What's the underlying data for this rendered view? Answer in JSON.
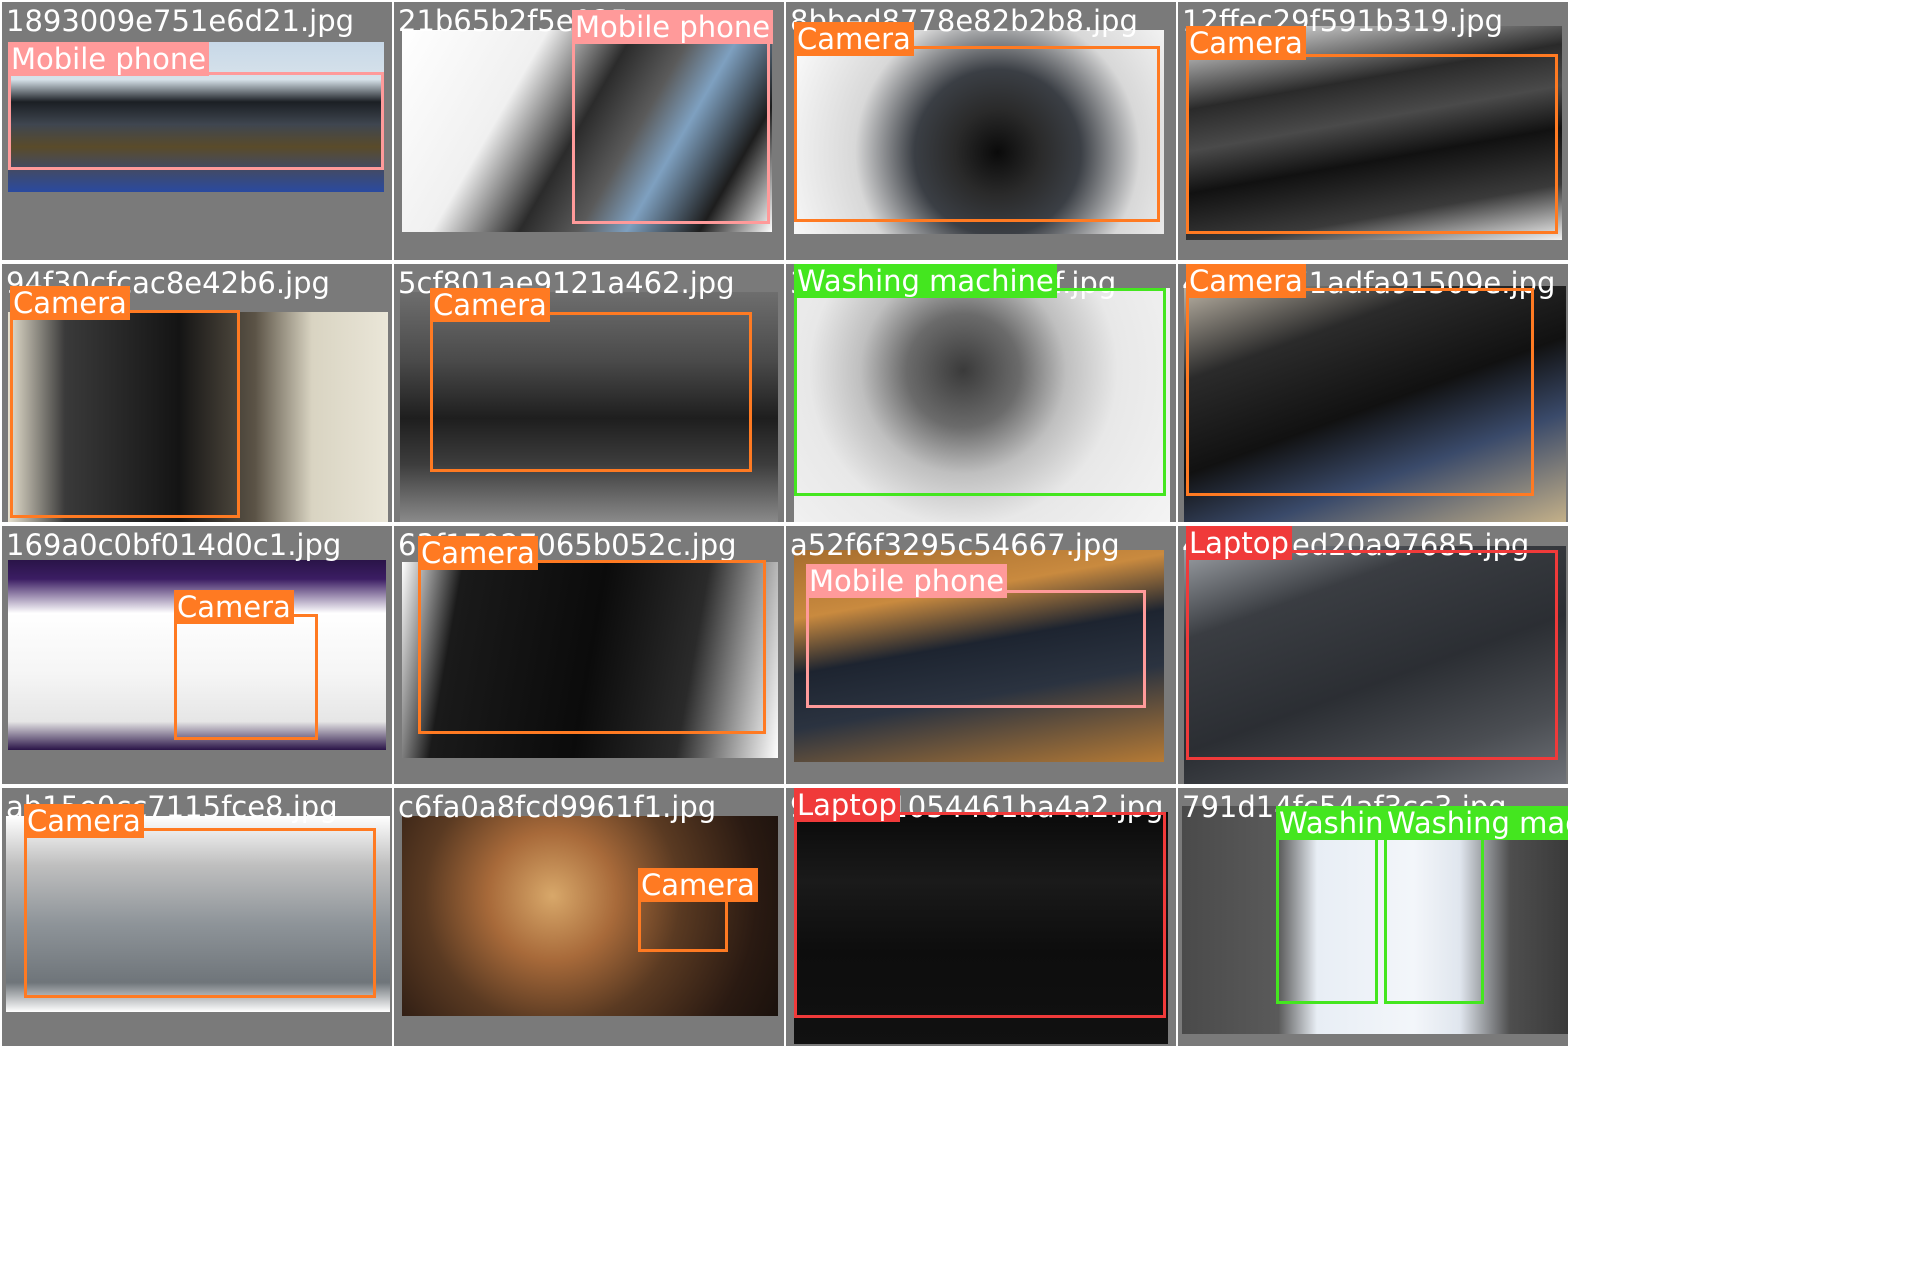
{
  "classes": {
    "Mobile phone": "#ff9a9a",
    "Camera": "#ff7a22",
    "Washing machine": "#44e61f",
    "Laptop": "#f03a3a"
  },
  "cells": [
    {
      "filename": "1893009e751e6d21.jpg",
      "photo_gradient": "linear-gradient(180deg,#c7d8e8 0%,#d7e2ea 25%,#1b1f24 40%,#3f4650 55%,#5a4b2a 70%,#2a4aa0 100%)",
      "detections": [
        {
          "label": "Mobile phone"
        }
      ]
    },
    {
      "filename": "21b65b2f5e025...",
      "photo_gradient": "linear-gradient(120deg,#ffffff 0%,#f0f0f0 30%,#2b2b2b 48%,#5a5a5a 60%,#7ea0c0 70%,#1d1d1d 85%,#ffffff 100%)",
      "detections": [
        {
          "label": "Mobile phone"
        }
      ]
    },
    {
      "filename": "8bbed8778e82b2b8.jpg",
      "photo_gradient": "radial-gradient(circle at 55% 60%,#0a0a0a 0%,#2a2a2a 18%,#3b3f45 35%,#d8d8d8 60%,#ffffff 100%)",
      "detections": [
        {
          "label": "Camera"
        }
      ]
    },
    {
      "filename": "12ffec29f591b319.jpg",
      "photo_gradient": "linear-gradient(170deg,#f4f4f4 0%,#2a2a2a 30%,#4a4a4a 45%,#111111 60%,#3a3a3a 80%,#f2f2f2 100%)",
      "detections": [
        {
          "label": "Camera"
        }
      ]
    },
    {
      "filename": "94f30cfcac8e42b6.jpg",
      "photo_gradient": "linear-gradient(90deg,#e7e1cf 0%,#3a3a3a 15%,#141414 45%,#5b5346 65%,#d9d4c2 80%,#eae6d8 100%)",
      "detections": [
        {
          "label": "Camera"
        }
      ]
    },
    {
      "filename": "5cf801ae9121a462.jpg",
      "photo_gradient": "linear-gradient(180deg,#6e6e6e 0%,#4a4a4a 30%,#1e1e1e 55%,#3d3d3d 75%,#8a8a8a 100%)",
      "detections": [
        {
          "label": "Camera"
        }
      ]
    },
    {
      "filename": "3a8c1f6be5d09e4f.jpg",
      "photo_gradient": "radial-gradient(circle at 45% 35%,#3a3a3a 0%,#6b6b6b 22%,#bfbfbf 40%,#e8e8e8 60%,#f4f4f4 100%)",
      "detections": [
        {
          "label": "Washing machine"
        }
      ]
    },
    {
      "filename": "4b6c2d71adfa91509e.jpg",
      "photo_gradient": "linear-gradient(160deg,#bcb4a6 0%,#2b2b2b 25%,#111111 50%,#3a4a6a 70%,#c9b48a 100%)",
      "detections": [
        {
          "label": "Camera"
        }
      ]
    },
    {
      "filename": "169a0c0bf014d0c1.jpg",
      "photo_gradient": "linear-gradient(180deg,#2a1448 0%,#3b1d63 10%,#ffffff 28%,#f5f5f5 60%,#e6e6e6 85%,#2a1448 100%)",
      "detections": [
        {
          "label": "Camera"
        }
      ]
    },
    {
      "filename": "63f17927065b052c.jpg",
      "photo_gradient": "linear-gradient(100deg,#ffffff 0%,#1a1a1a 15%,#0b0b0b 50%,#2a2a2a 75%,#ffffff 100%)",
      "detections": [
        {
          "label": "Camera"
        }
      ]
    },
    {
      "filename": "a52f6f3295c54667.jpg",
      "photo_gradient": "linear-gradient(170deg,#a66d2e 0%,#c98a3f 25%,#1d2430 45%,#2b3340 65%,#b57a35 100%)",
      "detections": [
        {
          "label": "Mobile phone"
        }
      ]
    },
    {
      "filename": "4d7be9ed20a97685.jpg",
      "photo_gradient": "linear-gradient(160deg,#9fa3a8 0%,#3a3d42 25%,#2b2e33 55%,#4a4d52 80%,#6f7278 100%)",
      "detections": [
        {
          "label": "Laptop"
        }
      ]
    },
    {
      "filename": "ab15e0cc7115fce8.jpg",
      "photo_gradient": "linear-gradient(180deg,#ffffff 0%,#bfbfbf 25%,#8e9499 55%,#6f757a 85%,#ffffff 100%)",
      "detections": [
        {
          "label": "Camera"
        }
      ]
    },
    {
      "filename": "c6fa0a8fcd9961f1.jpg",
      "photo_gradient": "radial-gradient(circle at 40% 40%,#d8a86a 0%,#a86a3a 25%,#5a3a22 50%,#2a1a12 80%,#1a110c 100%)",
      "detections": [
        {
          "label": "Camera"
        }
      ]
    },
    {
      "filename": "9f2e7c1054461ba4a2.jpg",
      "photo_gradient": "linear-gradient(180deg,#0a0a0a 0%,#1a1a1a 30%,#0d0d0d 60%,#111111 100%)",
      "detections": [
        {
          "label": "Laptop"
        }
      ]
    },
    {
      "filename": "791d14fc54af3cc3.jpg",
      "photo_gradient": "linear-gradient(90deg,#4a4a4a 0%,#5a5a5a 25%,#e8eef5 35%,#f3f6fa 60%,#e0e6ee 72%,#4e4e4e 85%,#3a3a3a 100%)",
      "detections": [
        {
          "label": "Washing"
        },
        {
          "label": "Washing machine"
        }
      ]
    }
  ]
}
